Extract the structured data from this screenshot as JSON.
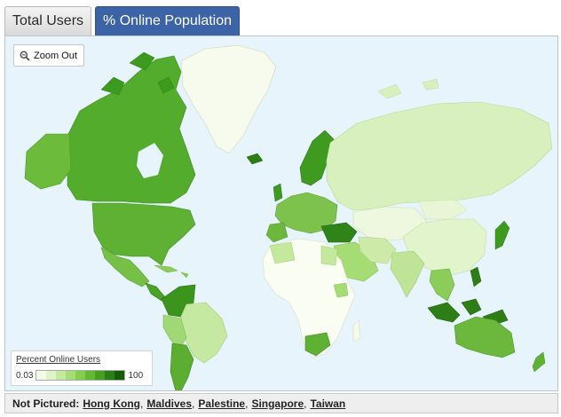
{
  "tabs": [
    {
      "label": "Total Users",
      "active": false
    },
    {
      "label": "% Online Population",
      "active": true
    }
  ],
  "map": {
    "zoom_label": "Zoom Out",
    "ocean_color": "#e8f4fb",
    "legend": {
      "title": "Percent Online Users",
      "min": "0.03",
      "max": "100",
      "colors": [
        "#f4fbe8",
        "#dff3c6",
        "#c4e99c",
        "#a6dc74",
        "#86cc4d",
        "#65b832",
        "#479f22",
        "#2c7f14",
        "#155c08"
      ]
    }
  },
  "footer": {
    "label": "Not Pictured:",
    "links": [
      "Hong Kong",
      "Maldives",
      "Palestine",
      "Singapore",
      "Taiwan"
    ]
  }
}
